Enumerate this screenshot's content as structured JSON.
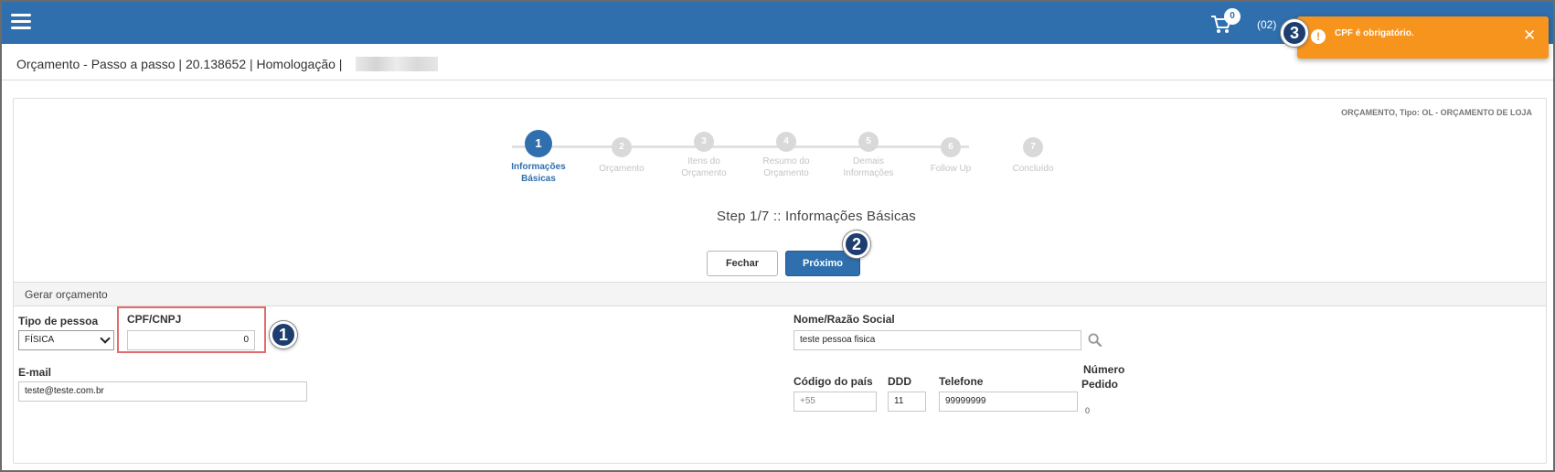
{
  "topbar": {
    "menu_icon": "hamburger-menu-icon",
    "cart_icon": "shopping-cart-icon",
    "cart_count": "0",
    "user_code": "(02)"
  },
  "toast": {
    "icon": "exclamation-icon",
    "message": "CPF é obrigatório.",
    "close_icon": "close-icon",
    "color": "#f7941d"
  },
  "callouts": [
    "1",
    "2",
    "3"
  ],
  "header": {
    "breadcrumb": "Orçamento - Passo a passo | 20.138652 | Homologação |"
  },
  "panel": {
    "quote_type": "ORÇAMENTO, Tipo: OL - ORÇAMENTO DE LOJA",
    "steps": [
      {
        "number": "1",
        "label_line1": "Informações",
        "label_line2": "Básicas",
        "active": true
      },
      {
        "number": "2",
        "label_line1": "Orçamento",
        "label_line2": "",
        "active": false
      },
      {
        "number": "3",
        "label_line1": "Itens do",
        "label_line2": "Orçamento",
        "active": false
      },
      {
        "number": "4",
        "label_line1": "Resumo do",
        "label_line2": "Orçamento",
        "active": false
      },
      {
        "number": "5",
        "label_line1": "Demais",
        "label_line2": "Informações",
        "active": false
      },
      {
        "number": "6",
        "label_line1": "Follow Up",
        "label_line2": "",
        "active": false
      },
      {
        "number": "7",
        "label_line1": "Concluído",
        "label_line2": "",
        "active": false
      }
    ],
    "step_title": "Step 1/7 :: Informações Básicas",
    "buttons": {
      "close": "Fechar",
      "next": "Próximo"
    },
    "section_title": "Gerar orçamento"
  },
  "form": {
    "tipo_pessoa": {
      "label": "Tipo de pessoa",
      "value": "FÍSICA"
    },
    "cpf_cnpj": {
      "label": "CPF/CNPJ",
      "value": "0"
    },
    "nome": {
      "label": "Nome/Razão Social",
      "value": "teste pessoa fisica",
      "search_icon": "search-icon"
    },
    "email": {
      "label": "E-mail",
      "value": "teste@teste.com.br"
    },
    "codigo_pais": {
      "label": "Código do país",
      "value": "+55"
    },
    "ddd": {
      "label": "DDD",
      "value": "11"
    },
    "telefone": {
      "label": "Telefone",
      "value": "99999999"
    },
    "numero_pedido": {
      "label_line1": "Número",
      "label_line2": "Pedido",
      "value": "0"
    }
  }
}
